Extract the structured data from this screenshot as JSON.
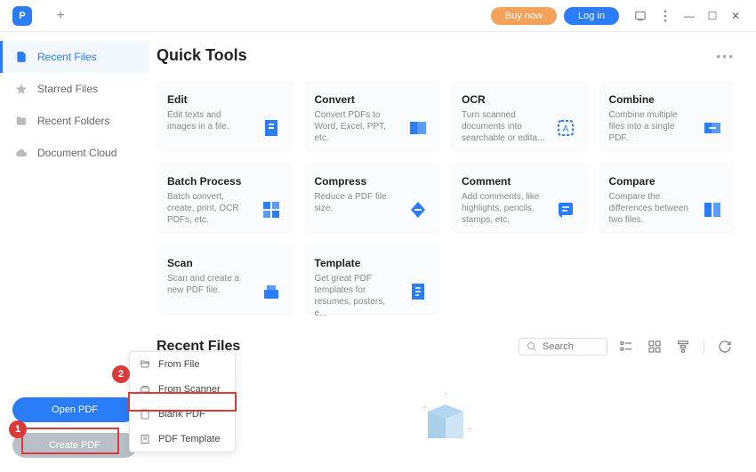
{
  "titlebar": {
    "buy_now": "Buy now",
    "login": "Log in"
  },
  "sidebar": {
    "items": [
      {
        "label": "Recent Files",
        "icon": "file-icon",
        "active": true
      },
      {
        "label": "Starred Files",
        "icon": "star-icon",
        "active": false
      },
      {
        "label": "Recent Folders",
        "icon": "folder-icon",
        "active": false
      },
      {
        "label": "Document Cloud",
        "icon": "cloud-icon",
        "active": false
      }
    ],
    "open_pdf": "Open PDF",
    "create_pdf": "Create PDF"
  },
  "quick_tools": {
    "title": "Quick Tools",
    "cards": [
      {
        "title": "Edit",
        "desc": "Edit texts and images in a file.",
        "color": "#2a7cf7"
      },
      {
        "title": "Convert",
        "desc": "Convert PDFs to Word, Excel, PPT, etc.",
        "color": "#2a7cf7"
      },
      {
        "title": "OCR",
        "desc": "Turn scanned documents into searchable or edita...",
        "color": "#2a7cf7"
      },
      {
        "title": "Combine",
        "desc": "Combine multiple files into a single PDF.",
        "color": "#2a7cf7"
      },
      {
        "title": "Batch Process",
        "desc": "Batch convert, create, print, OCR PDFs, etc.",
        "color": "#2a7cf7"
      },
      {
        "title": "Compress",
        "desc": "Reduce a PDF file size.",
        "color": "#2a7cf7"
      },
      {
        "title": "Comment",
        "desc": "Add comments, like highlights, pencils, stamps, etc.",
        "color": "#2a7cf7"
      },
      {
        "title": "Compare",
        "desc": "Compare the differences between two files.",
        "color": "#2a7cf7"
      },
      {
        "title": "Scan",
        "desc": "Scan and create a new PDF file.",
        "color": "#2a7cf7"
      },
      {
        "title": "Template",
        "desc": "Get great PDF templates for resumes, posters, e...",
        "color": "#2a7cf7"
      }
    ]
  },
  "recent_files": {
    "title": "Recent Files",
    "search_placeholder": "Search"
  },
  "context_menu": {
    "items": [
      {
        "label": "From File",
        "icon": "folder-open-icon"
      },
      {
        "label": "From Scanner",
        "icon": "scanner-icon"
      },
      {
        "label": "Blank PDF",
        "icon": "blank-page-icon"
      },
      {
        "label": "PDF Template",
        "icon": "template-icon"
      }
    ]
  },
  "callouts": {
    "one": "1",
    "two": "2"
  }
}
